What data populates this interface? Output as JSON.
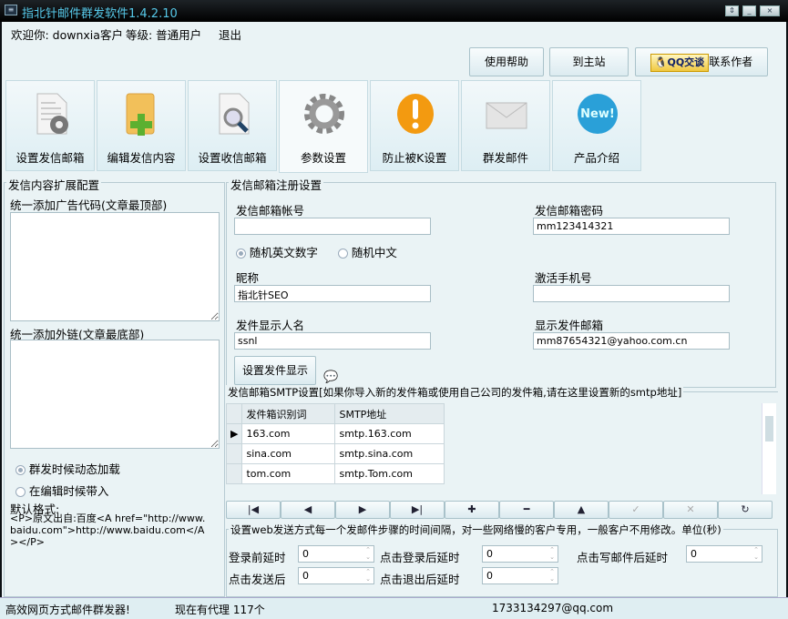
{
  "window": {
    "title": "指北针邮件群发软件1.4.2.10",
    "controls": [
      "⇕",
      "_",
      "×"
    ]
  },
  "header": {
    "welcome": "欢迎你: downxia客户",
    "level": "等级: 普通用户",
    "logout": "退出"
  },
  "buttons": {
    "help": "使用帮助",
    "home": "到主站",
    "qq": "QQ交谈",
    "contact": "联系作者"
  },
  "tabs": [
    {
      "label": "设置发信邮箱"
    },
    {
      "label": "编辑发信内容"
    },
    {
      "label": "设置收信邮箱"
    },
    {
      "label": "参数设置"
    },
    {
      "label": "防止被K设置"
    },
    {
      "label": "群发邮件"
    },
    {
      "label": "产品介绍"
    }
  ],
  "left": {
    "title": "发信内容扩展配置",
    "ad_label": "统一添加广告代码(文章最顶部)",
    "link_label": "统一添加外链(文章最底部)",
    "radio1": "群发时候动态加载",
    "radio2": "在编辑时候带入",
    "default_label": "默认格式:",
    "default_text": "<P>原文出自:百度<A href=\"http://www.baidu.com\">http://www.baidu.com</A></P>"
  },
  "reg": {
    "title": "发信邮箱注册设置",
    "account_label": "发信邮箱帐号",
    "account": "",
    "password_label": "发信邮箱密码",
    "password": "mm123414321",
    "radio_en": "随机英文数字",
    "radio_cn": "随机中文",
    "nick_label": "昵称",
    "nick": "指北针SEO",
    "phone_label": "激活手机号",
    "phone": "",
    "sender_label": "发件显示人名",
    "sender": "ssnl",
    "showmail_label": "显示发件邮箱",
    "showmail": "mm87654321@yahoo.com.cn",
    "set_button": "设置发件显示"
  },
  "smtp": {
    "title": "发信邮箱SMTP设置[如果你导入新的发件箱或使用自己公司的发件箱,请在这里设置新的smtp地址]",
    "columns": [
      "发件箱识别词",
      "SMTP地址"
    ],
    "rows": [
      [
        "163.com",
        "smtp.163.com"
      ],
      [
        "sina.com",
        "smtp.sina.com"
      ],
      [
        "tom.com",
        "smtp.Tom.com"
      ]
    ]
  },
  "nav": [
    "|◀",
    "◀",
    "▶",
    "▶|",
    "✚",
    "━",
    "▲",
    "✓",
    "✕",
    "↻"
  ],
  "delay": {
    "title": "设置web发送方式每一个发邮件步骤的时间间隔，对一些网络慢的客户专用，一般客户不用修改。单位(秒)",
    "before_login": "登录前延时",
    "before_login_v": "0",
    "after_login": "点击登录后延时",
    "after_login_v": "0",
    "after_write": "点击写邮件后延时",
    "after_write_v": "0",
    "after_send": "点击发送后",
    "after_send_v": "0",
    "after_logout": "点击退出后延时",
    "after_logout_v": "0"
  },
  "status": {
    "slogan": "高效网页方式邮件群发器!",
    "proxy": "现在有代理 117个",
    "email": "1733134297@qq.com"
  }
}
